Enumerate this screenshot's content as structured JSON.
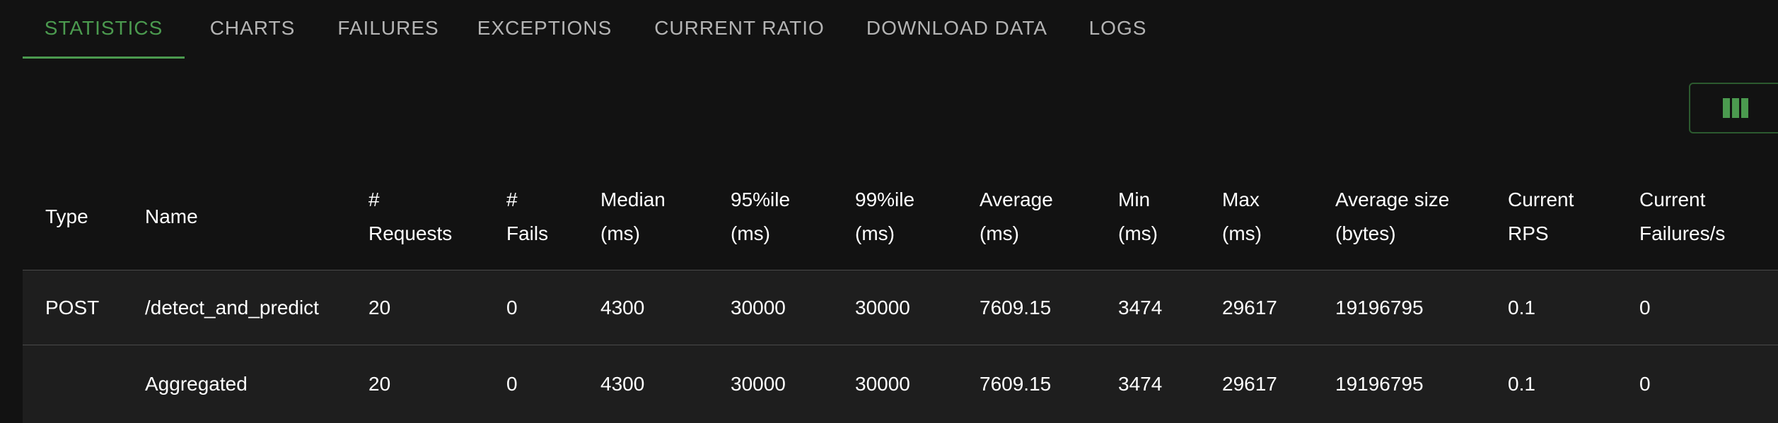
{
  "tabs": [
    {
      "label": "STATISTICS"
    },
    {
      "label": "CHARTS"
    },
    {
      "label": "FAILURES"
    },
    {
      "label": "EXCEPTIONS"
    },
    {
      "label": "CURRENT RATIO"
    },
    {
      "label": "DOWNLOAD DATA"
    },
    {
      "label": "LOGS"
    }
  ],
  "active_tab": "STATISTICS",
  "colors": {
    "accent": "#4b9a4f",
    "background": "#121212",
    "row_background": "#1e1e1e"
  },
  "columns_button": {
    "icon": "view-columns-icon"
  },
  "table": {
    "headers": [
      {
        "line1": "Type",
        "line2": ""
      },
      {
        "line1": "Name",
        "line2": ""
      },
      {
        "line1": "#",
        "line2": "Requests"
      },
      {
        "line1": "#",
        "line2": "Fails"
      },
      {
        "line1": "Median",
        "line2": "(ms)"
      },
      {
        "line1": "95%ile",
        "line2": "(ms)"
      },
      {
        "line1": "99%ile",
        "line2": "(ms)"
      },
      {
        "line1": "Average",
        "line2": "(ms)"
      },
      {
        "line1": "Min",
        "line2": "(ms)"
      },
      {
        "line1": "Max",
        "line2": "(ms)"
      },
      {
        "line1": "Average size",
        "line2": "(bytes)"
      },
      {
        "line1": "Current",
        "line2": "RPS"
      },
      {
        "line1": "Current",
        "line2": "Failures/s"
      }
    ],
    "rows": [
      [
        "POST",
        "/detect_and_predict",
        "20",
        "0",
        "4300",
        "30000",
        "30000",
        "7609.15",
        "3474",
        "29617",
        "19196795",
        "0.1",
        "0"
      ],
      [
        "",
        "Aggregated",
        "20",
        "0",
        "4300",
        "30000",
        "30000",
        "7609.15",
        "3474",
        "29617",
        "19196795",
        "0.1",
        "0"
      ]
    ]
  }
}
